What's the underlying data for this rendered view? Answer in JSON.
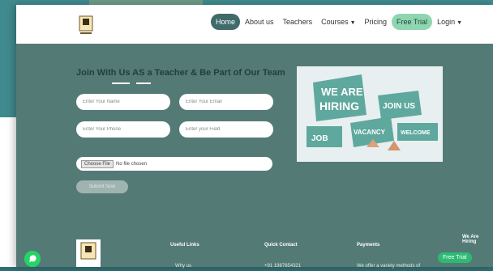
{
  "nav": {
    "items": [
      {
        "label": "Home",
        "active": true
      },
      {
        "label": "About us"
      },
      {
        "label": "Teachers"
      },
      {
        "label": "Courses",
        "dropdown": true
      },
      {
        "label": "Pricing"
      },
      {
        "label": "Free Trial",
        "highlight": true
      },
      {
        "label": "Login",
        "dropdown": true
      }
    ]
  },
  "form": {
    "heading": "Join With Us AS a Teacher & Be Part of Our Team",
    "name_placeholder": "Enter Your Name",
    "email_placeholder": "Enter Your Email",
    "phone_placeholder": "Enter Your Phone",
    "subject_placeholder": "Enter your Field",
    "file_button": "Choose File",
    "file_status": "No file chosen",
    "submit_label": "Submit Now"
  },
  "banner": {
    "signs": [
      "WE ARE",
      "HIRING",
      "JOIN US",
      "VACANCY",
      "JOB",
      "WELCOME"
    ]
  },
  "footer": {
    "useful_links_title": "Useful Links",
    "quick_contact_title": "Quick Contact",
    "payments_title": "Payments",
    "useful_links_first": "Why us",
    "quick_contact_first": "+91 1987654321",
    "payments_text": "We offer a variety methods of"
  },
  "floating": {
    "free_trial_label": "Free Trial",
    "hiring_badge": "We Are Hiring"
  },
  "colors": {
    "accent": "#3f6b6a",
    "trial": "#8fd6b0",
    "whatsapp": "#25d366"
  }
}
